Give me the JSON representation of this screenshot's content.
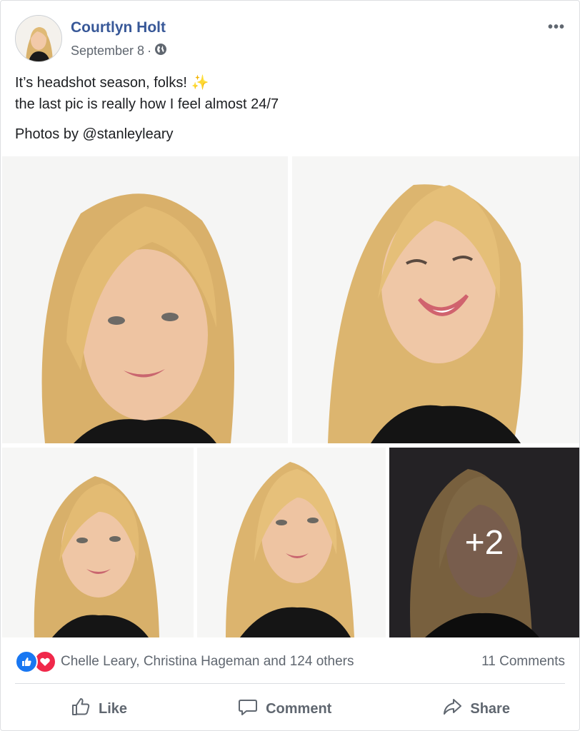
{
  "post": {
    "author": "Courtlyn Holt",
    "date": "September 8",
    "separator": "·",
    "more_label": "•••",
    "text_line1": "It’s headshot season, folks!",
    "sparkle_emoji": "✨",
    "text_line2": "the last pic is really how I feel almost 24/7",
    "credit": "Photos by @stanleyleary"
  },
  "photos": {
    "extra_count_label": "+2",
    "items": [
      {
        "name": "photo-1"
      },
      {
        "name": "photo-2"
      },
      {
        "name": "photo-3"
      },
      {
        "name": "photo-4"
      },
      {
        "name": "photo-5"
      }
    ]
  },
  "reactions": {
    "types": [
      "like-icon",
      "love-icon"
    ],
    "names": "Chelle Leary, Christina Hageman and 124 others",
    "comments": "11 Comments"
  },
  "actions": {
    "like": "Like",
    "comment": "Comment",
    "share": "Share"
  },
  "colors": {
    "author_link": "#385898",
    "muted_text": "#606770",
    "like_blue": "#1877f2",
    "love_red": "#f0284a"
  }
}
